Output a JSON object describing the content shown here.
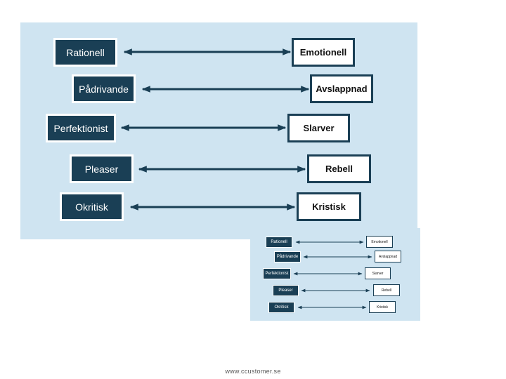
{
  "diagram": {
    "pairs": [
      {
        "left": "Rationell",
        "right": "Emotionell"
      },
      {
        "left": "Pådrivande",
        "right": "Avslappnad"
      },
      {
        "left": "Perfektionist",
        "right": "Slarver"
      },
      {
        "left": "Pleaser",
        "right": "Rebell"
      },
      {
        "left": "Okritisk",
        "right": "Kristisk"
      }
    ],
    "connector": "double-headed-arrow"
  },
  "thumbnail": {
    "pairs": [
      {
        "left": "Rationell",
        "right": "Emotionell"
      },
      {
        "left": "Pådrivande",
        "right": "Avslappnad"
      },
      {
        "left": "Perfektionist",
        "right": "Slarver"
      },
      {
        "left": "Pleaser",
        "right": "Rebell"
      },
      {
        "left": "Okritisk",
        "right": "Kristisk"
      }
    ]
  },
  "colors": {
    "panel": "#cfe4f1",
    "box_dark": "#1a3f55",
    "arrow": "#1a3f55"
  },
  "footer": {
    "url": "www.ccustomer.se"
  }
}
